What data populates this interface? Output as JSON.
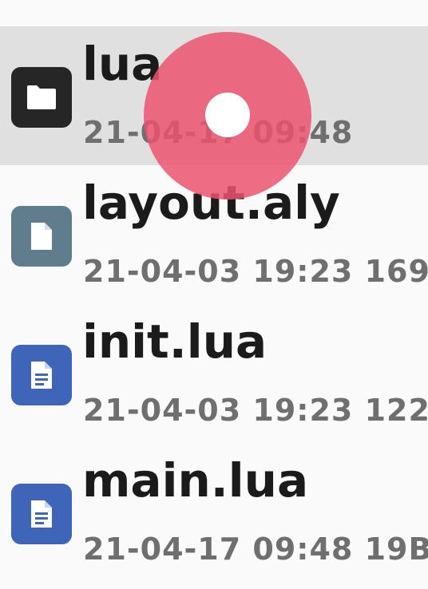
{
  "files": [
    {
      "name": "lua",
      "meta": "21-04-17 09:48",
      "type": "folder",
      "icon": "folder-icon",
      "icon_color": "#262626",
      "selected": true
    },
    {
      "name": "layout.aly",
      "meta": "21-04-03 19:23 169",
      "type": "file",
      "icon": "file-icon",
      "icon_color": "#5f7d8c",
      "selected": false
    },
    {
      "name": "init.lua",
      "meta": "21-04-03 19:23 122",
      "type": "document",
      "icon": "document-icon",
      "icon_color": "#3f65b8",
      "selected": false
    },
    {
      "name": "main.lua",
      "meta": "21-04-17 09:48 19B",
      "type": "document",
      "icon": "document-icon",
      "icon_color": "#3f65b8",
      "selected": false
    }
  ],
  "colors": {
    "background": "#fafafa",
    "selected_row": "#e0e0e0",
    "name_text": "#1b1b1b",
    "meta_text": "#6f6f6f",
    "touch_indicator": "#ec546e"
  }
}
